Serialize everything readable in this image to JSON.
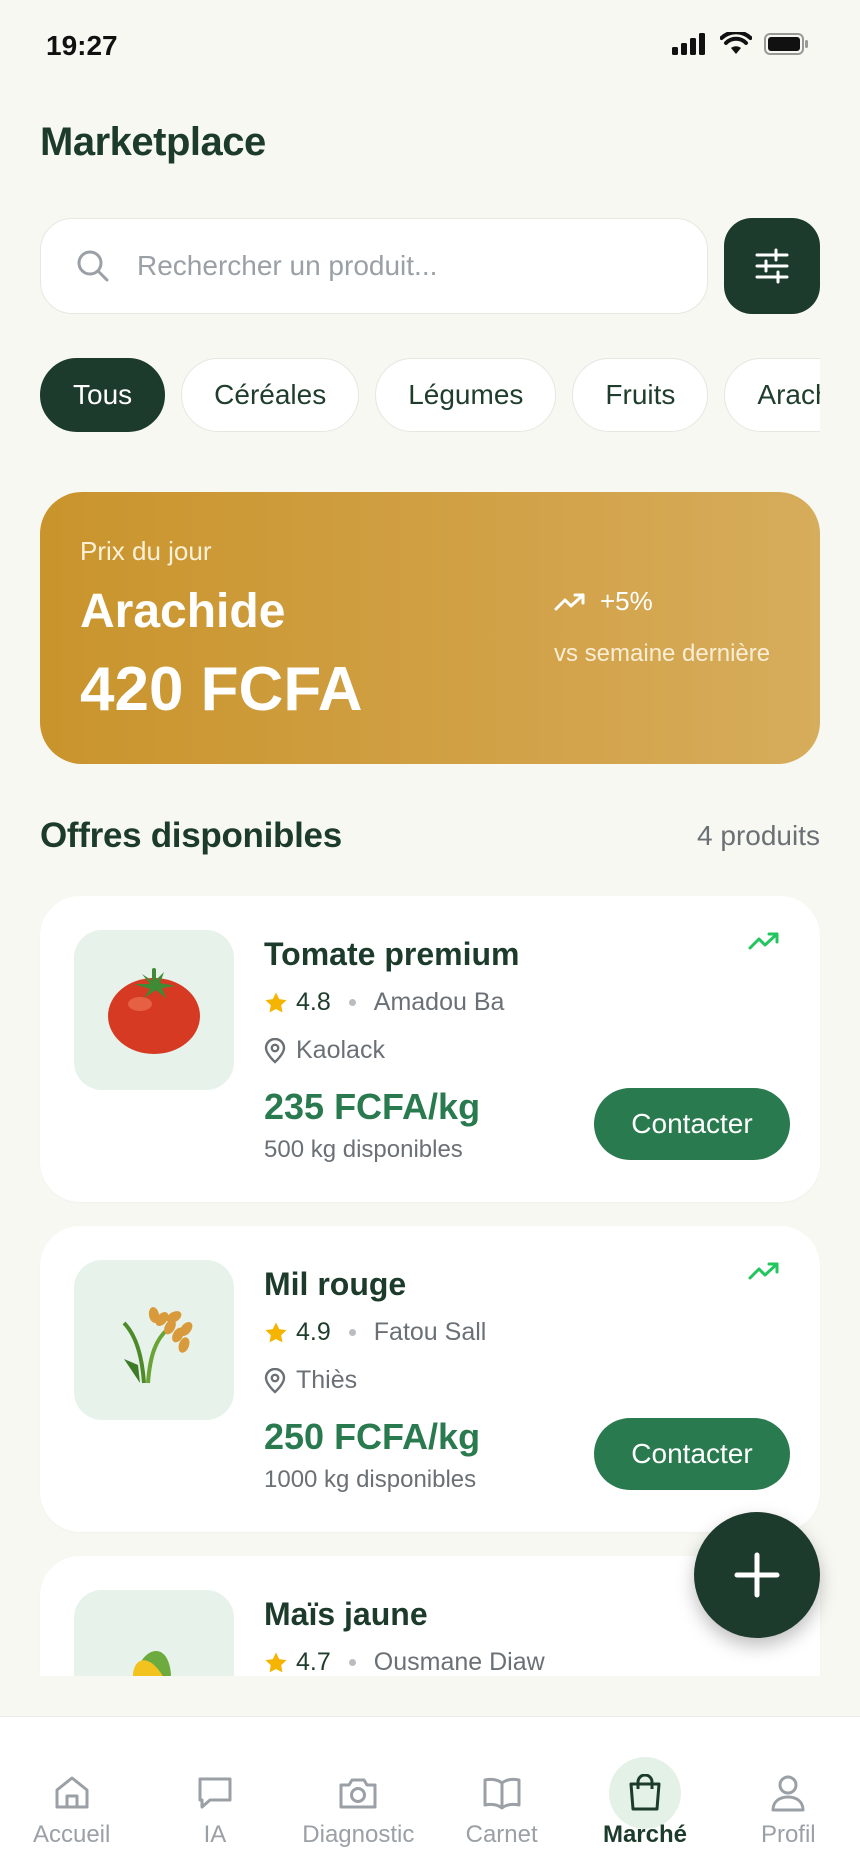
{
  "status": {
    "time": "19:27"
  },
  "page": {
    "title": "Marketplace"
  },
  "search": {
    "placeholder": "Rechercher un produit..."
  },
  "categories": [
    "Tous",
    "Céréales",
    "Légumes",
    "Fruits",
    "Arachide"
  ],
  "active_category": "Tous",
  "price_of_day": {
    "label": "Prix du jour",
    "product": "Arachide",
    "price": "420 FCFA",
    "change": "+5%",
    "comparison": "vs semaine dernière"
  },
  "offers_section": {
    "title": "Offres disponibles",
    "count": "4 produits"
  },
  "offers": [
    {
      "name": "Tomate premium",
      "rating": "4.8",
      "seller": "Amadou Ba",
      "location": "Kaolack",
      "price": "235 FCFA/kg",
      "stock": "500 kg disponibles",
      "contact_label": "Contacter",
      "icon": "tomato-icon"
    },
    {
      "name": "Mil rouge",
      "rating": "4.9",
      "seller": "Fatou Sall",
      "location": "Thiès",
      "price": "250 FCFA/kg",
      "stock": "1000 kg disponibles",
      "contact_label": "Contacter",
      "icon": "millet-icon"
    },
    {
      "name": "Maïs jaune",
      "rating": "4.7",
      "seller": "Ousmane Diaw",
      "icon": "corn-icon"
    }
  ],
  "nav": [
    {
      "label": "Accueil",
      "icon": "home-icon"
    },
    {
      "label": "IA",
      "icon": "chat-icon"
    },
    {
      "label": "Diagnostic",
      "icon": "camera-icon"
    },
    {
      "label": "Carnet",
      "icon": "book-icon"
    },
    {
      "label": "Marché",
      "icon": "shopping-bag-icon",
      "active": true
    },
    {
      "label": "Profil",
      "icon": "user-icon"
    }
  ],
  "colors": {
    "primary_dark": "#1d3b2c",
    "primary": "#2a7a4f",
    "gold": "#c9942c",
    "trend_green": "#22c55e",
    "star": "#f5b400"
  }
}
